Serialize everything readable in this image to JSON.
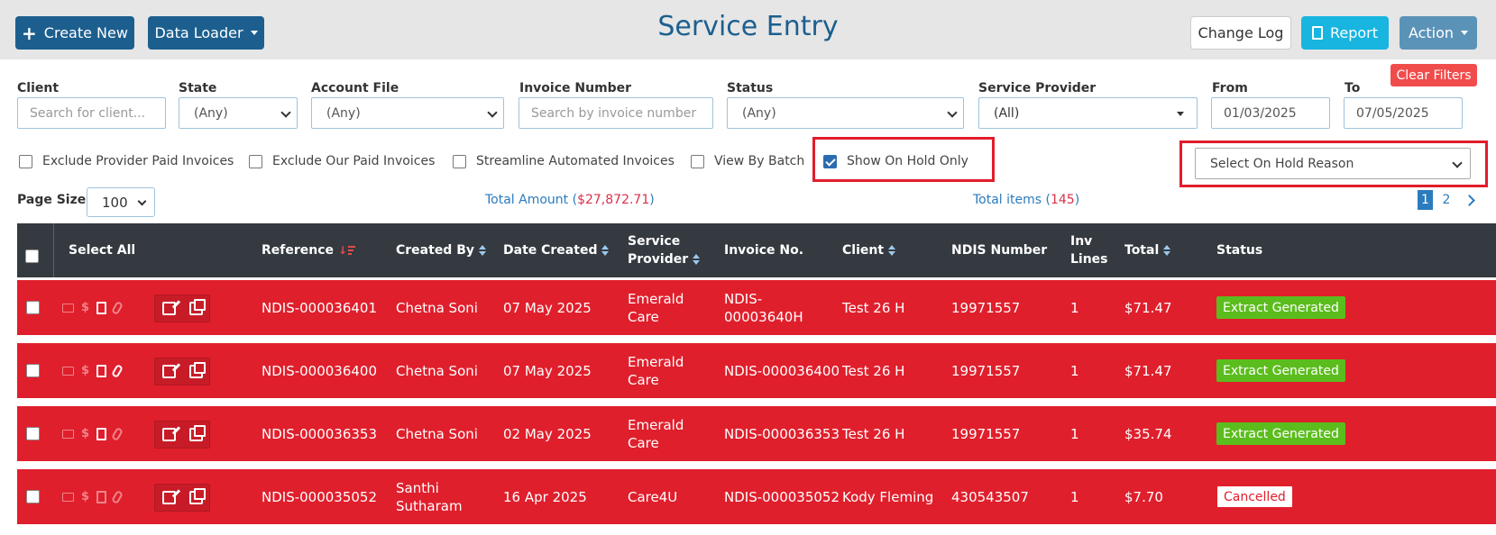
{
  "header": {
    "create_label": "Create New",
    "loader_label": "Data Loader",
    "title": "Service Entry",
    "changelog_label": "Change Log",
    "report_label": "Report",
    "action_label": "Action"
  },
  "filters": {
    "clear_label": "Clear Filters",
    "client": {
      "label": "Client",
      "placeholder": "Search for client..."
    },
    "state": {
      "label": "State",
      "value": "(Any)"
    },
    "account_file": {
      "label": "Account File",
      "value": "(Any)"
    },
    "invoice_number": {
      "label": "Invoice Number",
      "placeholder": "Search by invoice number"
    },
    "status": {
      "label": "Status",
      "value": "(Any)"
    },
    "service_provider": {
      "label": "Service Provider",
      "value": "(All)"
    },
    "from": {
      "label": "From",
      "value": "01/03/2025"
    },
    "to": {
      "label": "To",
      "value": "07/05/2025"
    }
  },
  "checkboxes": {
    "exclude_provider": "Exclude Provider Paid Invoices",
    "exclude_our": "Exclude Our Paid Invoices",
    "streamline": "Streamline Automated Invoices",
    "view_batch": "View By Batch",
    "on_hold": "Show On Hold Only"
  },
  "hold_reason": {
    "value": "Select On Hold Reason"
  },
  "summary": {
    "page_size_label": "Page Size:",
    "page_size_value": "100",
    "total_amount_label": "Total Amount (",
    "total_amount_value": "$27,872.71",
    "total_amount_close": ")",
    "total_items_label": "Total items (",
    "total_items_value": "145",
    "total_items_close": ")"
  },
  "pagination": {
    "current": "1",
    "next_page": "2"
  },
  "table": {
    "headers": {
      "select_all": "Select All",
      "reference": "Reference",
      "created_by": "Created By",
      "date_created": "Date Created",
      "service_provider_1": "Service",
      "service_provider_2": "Provider",
      "invoice_no": "Invoice No.",
      "client": "Client",
      "ndis_number": "NDIS Number",
      "inv_lines_1": "Inv",
      "inv_lines_2": "Lines",
      "total": "Total",
      "status": "Status"
    },
    "currency_symbol": "$",
    "rows": [
      {
        "reference": "NDIS-000036401",
        "created_by_1": "Chetna Soni",
        "created_by_2": "",
        "date": "07 May 2025",
        "provider_1": "Emerald",
        "provider_2": "Care",
        "invoice_1": "NDIS-",
        "invoice_2": "00003640H",
        "client": "Test 26 H",
        "ndis": "19971557",
        "lines": "1",
        "total": "$71.47",
        "status": "Extract Generated"
      },
      {
        "reference": "NDIS-000036400",
        "created_by_1": "Chetna Soni",
        "created_by_2": "",
        "date": "07 May 2025",
        "provider_1": "Emerald",
        "provider_2": "Care",
        "invoice_1": "NDIS-000036400",
        "invoice_2": "",
        "client": "Test 26 H",
        "ndis": "19971557",
        "lines": "1",
        "total": "$71.47",
        "status": "Extract Generated"
      },
      {
        "reference": "NDIS-000036353",
        "created_by_1": "Chetna Soni",
        "created_by_2": "",
        "date": "02 May 2025",
        "provider_1": "Emerald",
        "provider_2": "Care",
        "invoice_1": "NDIS-000036353",
        "invoice_2": "",
        "client": "Test 26 H",
        "ndis": "19971557",
        "lines": "1",
        "total": "$35.74",
        "status": "Extract Generated"
      },
      {
        "reference": "NDIS-000035052",
        "created_by_1": "Santhi",
        "created_by_2": "Sutharam",
        "date": "16 Apr 2025",
        "provider_1": "Care4U",
        "provider_2": "",
        "invoice_1": "NDIS-000035052",
        "invoice_2": "",
        "client": "Kody Fleming",
        "ndis": "430543507",
        "lines": "1",
        "total": "$7.70",
        "status": "Cancelled"
      }
    ]
  }
}
